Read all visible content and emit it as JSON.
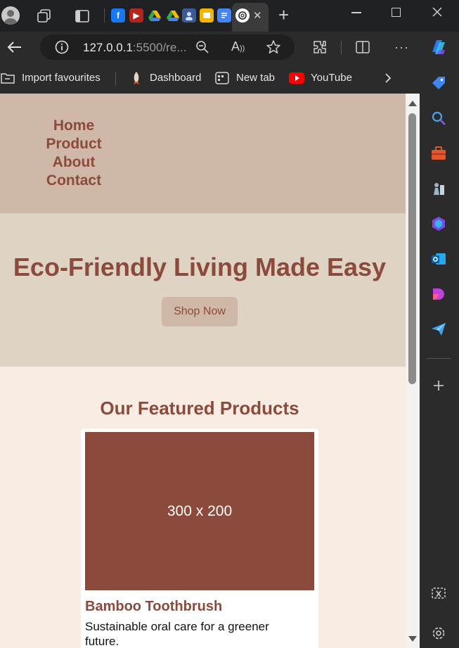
{
  "browser": {
    "address": {
      "host": "127.0.0.1",
      "rest": ":5500/re..."
    },
    "tab_close": "✕",
    "new_tab": "+",
    "bookmarks": [
      {
        "label": "Import favourites",
        "icon": "folder-import-icon"
      },
      {
        "label": "Dashboard",
        "icon": "rocket-icon"
      },
      {
        "label": "New tab",
        "icon": "new-tab-icon"
      },
      {
        "label": "YouTube",
        "icon": "youtube-icon"
      }
    ],
    "read_aloud": "A"
  },
  "site": {
    "nav": [
      "Home",
      "Product",
      "About",
      "Contact"
    ],
    "hero": {
      "title": "Eco-Friendly Living Made Easy",
      "button": "Shop Now"
    },
    "featured": {
      "title": "Our Featured Products",
      "products": [
        {
          "image_label": "300 x 200",
          "name": "Bamboo Toothbrush",
          "description": "Sustainable oral care for a greener future."
        }
      ]
    }
  },
  "colors": {
    "brand": "#8b4a3b",
    "header_bg": "#d0b8a8",
    "hero_bg": "#dfd3c3",
    "page_bg": "#f8ece3"
  }
}
